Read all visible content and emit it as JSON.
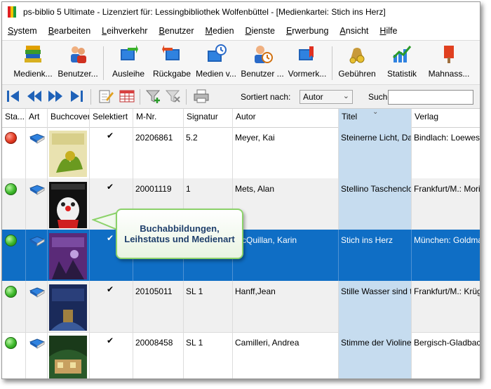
{
  "window": {
    "title": "ps-biblio 5 Ultimate - Lizenziert für: Lessingbibliothek Wolfenbüttel - [Medienkartei: Stich ins Herz]"
  },
  "menu": [
    {
      "label": "System",
      "u": "S",
      "rest": "ystem"
    },
    {
      "label": "Bearbeiten",
      "u": "B",
      "rest": "earbeiten"
    },
    {
      "label": "Leihverkehr",
      "u": "L",
      "rest": "eihverkehr"
    },
    {
      "label": "Benutzer",
      "u": "B",
      "rest": "enutzer"
    },
    {
      "label": "Medien",
      "u": "M",
      "rest": "edien"
    },
    {
      "label": "Dienste",
      "u": "D",
      "rest": "ienste"
    },
    {
      "label": "Erwerbung",
      "u": "E",
      "rest": "rwerbung"
    },
    {
      "label": "Ansicht",
      "u": "A",
      "rest": "nsicht"
    },
    {
      "label": "Hilfe",
      "u": "H",
      "rest": "ilfe"
    }
  ],
  "toolbar": {
    "buttons": [
      {
        "label": "Medienk...",
        "icon": "books-icon"
      },
      {
        "label": "Benutzer...",
        "icon": "users-icon"
      },
      {
        "label": "Ausleihe",
        "icon": "checkout-icon"
      },
      {
        "label": "Rückgabe",
        "icon": "return-icon"
      },
      {
        "label": "Medien v...",
        "icon": "media-extend-icon"
      },
      {
        "label": "Benutzer ...",
        "icon": "user-clock-icon"
      },
      {
        "label": "Vormerk...",
        "icon": "reservation-icon"
      },
      {
        "label": "Gebühren",
        "icon": "money-bag-icon"
      },
      {
        "label": "Statistik",
        "icon": "chart-icon"
      },
      {
        "label": "Mahnass...",
        "icon": "reminder-icon"
      }
    ]
  },
  "navbar": {
    "sort_label": "Sortiert nach:",
    "sort_value": "Autor",
    "search_label": "Suche:",
    "search_value": ""
  },
  "columns": [
    "Sta...",
    "Art",
    "Buchcover",
    "Selektiert",
    "M-Nr.",
    "Signatur",
    "Autor",
    "Titel",
    "Verlag"
  ],
  "rows": [
    {
      "status": "red",
      "selected_check": "✔",
      "mnr": "20206861",
      "signatur": "5.2",
      "autor": "Meyer, Kai",
      "titel": "Steinerne Licht, Das.",
      "verlag": "Bindlach: Loewes",
      "cover": "cover-1"
    },
    {
      "status": "green",
      "selected_check": "✔",
      "mnr": "20001119",
      "signatur": "1",
      "autor": "Mets, Alan",
      "titel": "Stellino Taschenclov",
      "verlag": "Frankfurt/M.: Moritz",
      "cover": "cover-2"
    },
    {
      "status": "green",
      "selected_check": "✔",
      "mnr": "",
      "signatur": "",
      "autor": "McQuillan, Karin",
      "titel": "Stich ins Herz",
      "verlag": "München: Goldma",
      "cover": "cover-3"
    },
    {
      "status": "green",
      "selected_check": "✔",
      "mnr": "20105011",
      "signatur": "SL 1",
      "autor": "Hanff,Jean",
      "titel": "Stille Wasser sind tie",
      "verlag": "Frankfurt/M.: Krüg",
      "cover": "cover-4"
    },
    {
      "status": "green",
      "selected_check": "✔",
      "mnr": "20008458",
      "signatur": "SL 1",
      "autor": "Camilleri, Andrea",
      "titel": "Stimme der Violine, D",
      "verlag": "Bergisch-Gladbac",
      "cover": "cover-5"
    }
  ],
  "callout": {
    "line1": "Buchabbildungen,",
    "line2": "Leihstatus und Medienart"
  },
  "colors": {
    "selection": "#0f6ec5",
    "sorted_column": "#c6dcef",
    "callout_border": "#8cd26a"
  }
}
